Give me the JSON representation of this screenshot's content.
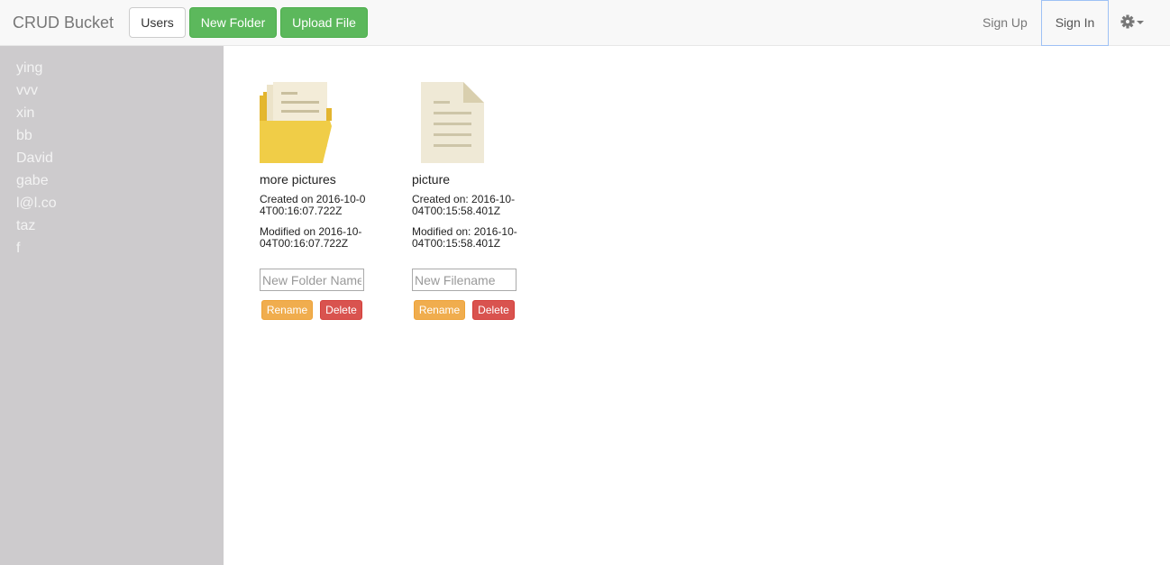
{
  "navbar": {
    "brand": "CRUD Bucket",
    "users_label": "Users",
    "new_folder_label": "New Folder",
    "upload_file_label": "Upload File",
    "sign_up_label": "Sign Up",
    "sign_in_label": "Sign In",
    "settings_icon": "gear-icon"
  },
  "sidebar": {
    "items": [
      {
        "label": "ying"
      },
      {
        "label": "vvv"
      },
      {
        "label": "xin"
      },
      {
        "label": "bb"
      },
      {
        "label": "David"
      },
      {
        "label": "gabe"
      },
      {
        "label": "l@l.co"
      },
      {
        "label": "taz"
      },
      {
        "label": "f"
      }
    ]
  },
  "items": [
    {
      "type": "folder",
      "icon": "folder-icon",
      "name": "more pictures",
      "created": "Created on 2016-10-04T00:16:07.722Z",
      "modified": "Modified on 2016-10-04T00:16:07.722Z",
      "input_placeholder": "New Folder Name",
      "rename_label": "Rename",
      "delete_label": "Delete"
    },
    {
      "type": "file",
      "icon": "document-icon",
      "name": "picture",
      "created": "Created on: 2016-10-04T00:15:58.401Z",
      "modified": "Modified on: 2016-10-04T00:15:58.401Z",
      "input_placeholder": "New Filename",
      "rename_label": "Rename",
      "delete_label": "Delete"
    }
  ],
  "colors": {
    "success": "#5cb85c",
    "warning": "#f0ad4e",
    "danger": "#d9534f",
    "sidebar_bg": "#cdcbcd",
    "folder_yellow": "#f0cd47"
  }
}
